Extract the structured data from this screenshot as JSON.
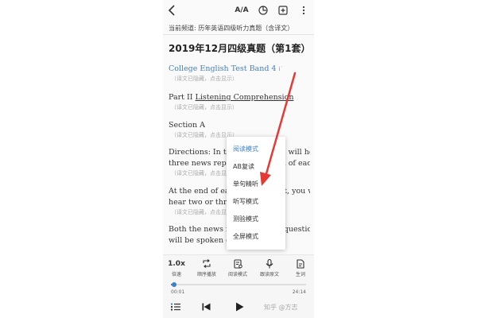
{
  "topbar": {
    "translate_label": "A/A",
    "icons": [
      "back-arrow-icon",
      "translate-icon",
      "timer-icon",
      "add-box-icon",
      "more-vertical-icon"
    ]
  },
  "channel": "当前频道: 历年英语四级听力真题（含译文）",
  "title": "2019年12月四级真题（第1套）",
  "paragraphs": [
    {
      "text": "College English Test Band 4",
      "hint": "（译文已隐藏，点击显示）"
    },
    {
      "text_prefix": "Part II ",
      "text_link": "Listening Comprehension",
      "hint": "（译文已隐藏，点击显示）"
    },
    {
      "text": "Section A",
      "hint": "（译文已隐藏，点击显示）"
    },
    {
      "line1": "Directions: In this section, you will hear",
      "line2": "three news reports. At the end of each",
      "hint": "（译文已隐藏，点击显示）"
    },
    {
      "line1": "At the end of each news report, you will",
      "line2": "hear two or three questions.",
      "hint": "（译文已隐藏，点击显示）"
    },
    {
      "line1": "Both the news report and the questions",
      "line2": "will be spoken only once.",
      "hint": "（译文已隐藏，点击显示）"
    }
  ],
  "menu": {
    "items": [
      "阅读模式",
      "AB复读",
      "单句精听",
      "听写模式",
      "测验模式",
      "全屏模式"
    ],
    "active_index": 0
  },
  "bottom": {
    "tools": [
      {
        "icon": "1.0x",
        "label": "倍速"
      },
      {
        "icon": "repeat-icon",
        "label": "顺序播放"
      },
      {
        "icon": "reading-mode-icon",
        "label": "阅读模式"
      },
      {
        "icon": "microphone-icon",
        "label": "跟读原文"
      },
      {
        "icon": "vocabulary-icon",
        "label": "生词"
      }
    ],
    "time_start": "00:01",
    "time_end": "24:14",
    "progress": 0.01,
    "watermark": "知乎 @方志"
  },
  "colors": {
    "accent": "#3f7fc4",
    "annotation": "#e53935"
  }
}
